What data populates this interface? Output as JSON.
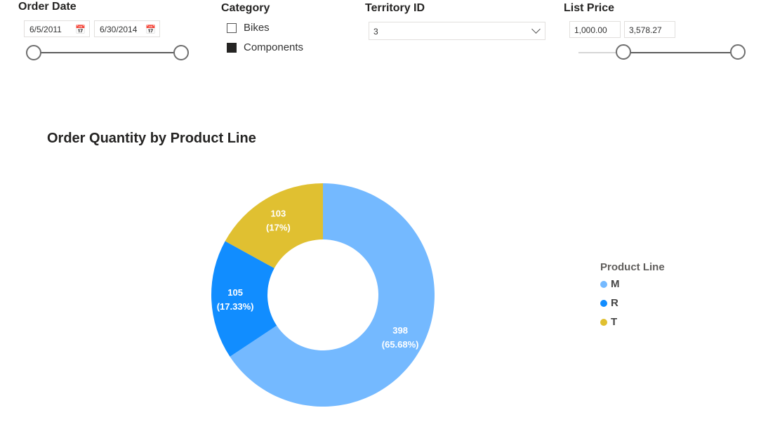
{
  "slicers": {
    "order_date": {
      "title": "Order Date",
      "start": "6/5/2011",
      "end": "6/30/2014",
      "calendar_icon": "calendar-icon"
    },
    "category": {
      "title": "Category",
      "items": [
        {
          "label": "Bikes",
          "checked": false
        },
        {
          "label": "Components",
          "checked": true
        }
      ]
    },
    "territory": {
      "title": "Territory ID",
      "selected": "3",
      "icon": "chevron-down-icon"
    },
    "list_price": {
      "title": "List Price",
      "min": "1,000.00",
      "max": "3,578.27"
    }
  },
  "chart_data": {
    "type": "pie",
    "donut": true,
    "title": "Order Quantity by Product Line",
    "legend_title": "Product Line",
    "legend_position": "right",
    "categories": [
      "M",
      "R",
      "T"
    ],
    "values": [
      398,
      105,
      103
    ],
    "percent_labels": [
      "(65.68%)",
      "(17.33%)",
      "(17%)"
    ],
    "colors": [
      "#74b9ff",
      "#118dff",
      "#e0c031"
    ]
  }
}
